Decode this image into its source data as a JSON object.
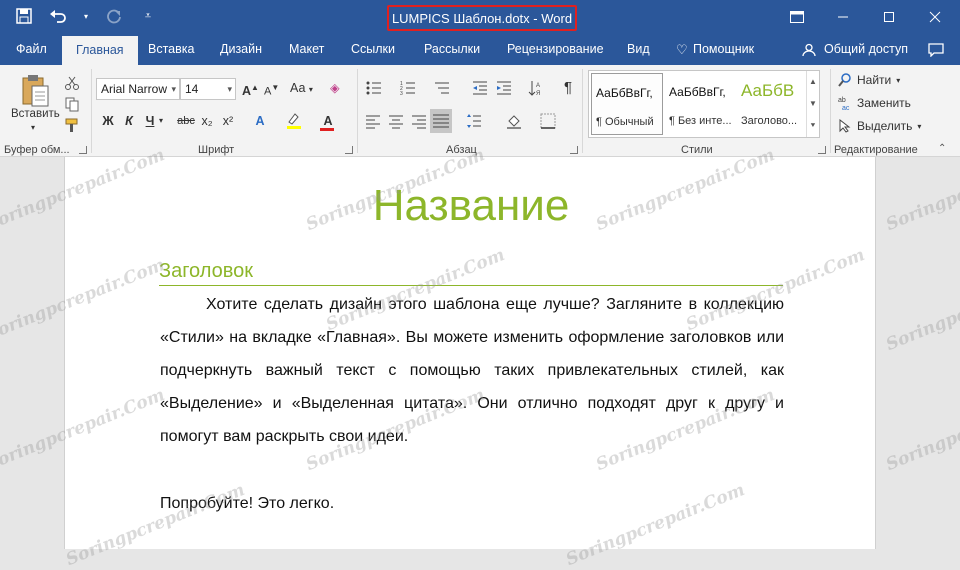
{
  "window": {
    "title": "LUMPICS Шаблон.dotx - Word",
    "controls": [
      "restore-ribbon",
      "minimize",
      "maximize",
      "close"
    ]
  },
  "qat": {
    "items": [
      "save-icon",
      "undo-icon",
      "redo-icon",
      "customize-icon"
    ]
  },
  "tabs": [
    {
      "label": "Файл"
    },
    {
      "label": "Главная",
      "active": true
    },
    {
      "label": "Вставка"
    },
    {
      "label": "Дизайн"
    },
    {
      "label": "Макет"
    },
    {
      "label": "Ссылки"
    },
    {
      "label": "Рассылки"
    },
    {
      "label": "Рецензирование"
    },
    {
      "label": "Вид"
    },
    {
      "label": "Помощник"
    }
  ],
  "share": {
    "label": "Общий доступ"
  },
  "ribbon": {
    "clipboard": {
      "paste_label": "Вставить",
      "group_label": "Буфер обм..."
    },
    "font": {
      "family": "Arial Narrow",
      "size": "14",
      "case_label": "Аа",
      "bold": "Ж",
      "italic": "К",
      "underline": "Ч",
      "strike": "abc",
      "sub": "x₂",
      "sup": "x²",
      "effects": "A",
      "font_color": "A",
      "group_label": "Шрифт"
    },
    "paragraph": {
      "group_label": "Абзац",
      "pilcrow": "¶"
    },
    "styles": {
      "group_label": "Стили",
      "items": [
        {
          "sample": "АаБбВвГг,",
          "name": "¶ Обычный"
        },
        {
          "sample": "АаБбВвГг,",
          "name": "¶ Без инте..."
        },
        {
          "sample": "АаБбВ",
          "name": "Заголово..."
        }
      ]
    },
    "editing": {
      "group_label": "Редактирование",
      "find": "Найти",
      "replace": "Заменить",
      "select": "Выделить"
    }
  },
  "document": {
    "title": "Название",
    "heading": "Заголовок",
    "paragraph": "Хотите сделать дизайн этого шаблона еще лучше? Загляните в коллекцию «Стили» на вкладке «Главная». Вы можете изменить оформление заголовков или подчеркнуть важный текст с помощью таких привлекательных стилей, как «Выделение» и «Выделенная цитата». Они отлично подходят друг к другу и помогут вам раскрыть свои идеи.",
    "paragraph2": "Попробуйте! Это легко."
  },
  "watermark": "Soringpcrepair.Com",
  "colors": {
    "title_bar": "#2b579a",
    "accent_green": "#8db62a",
    "highlight_box": "#e02020"
  }
}
